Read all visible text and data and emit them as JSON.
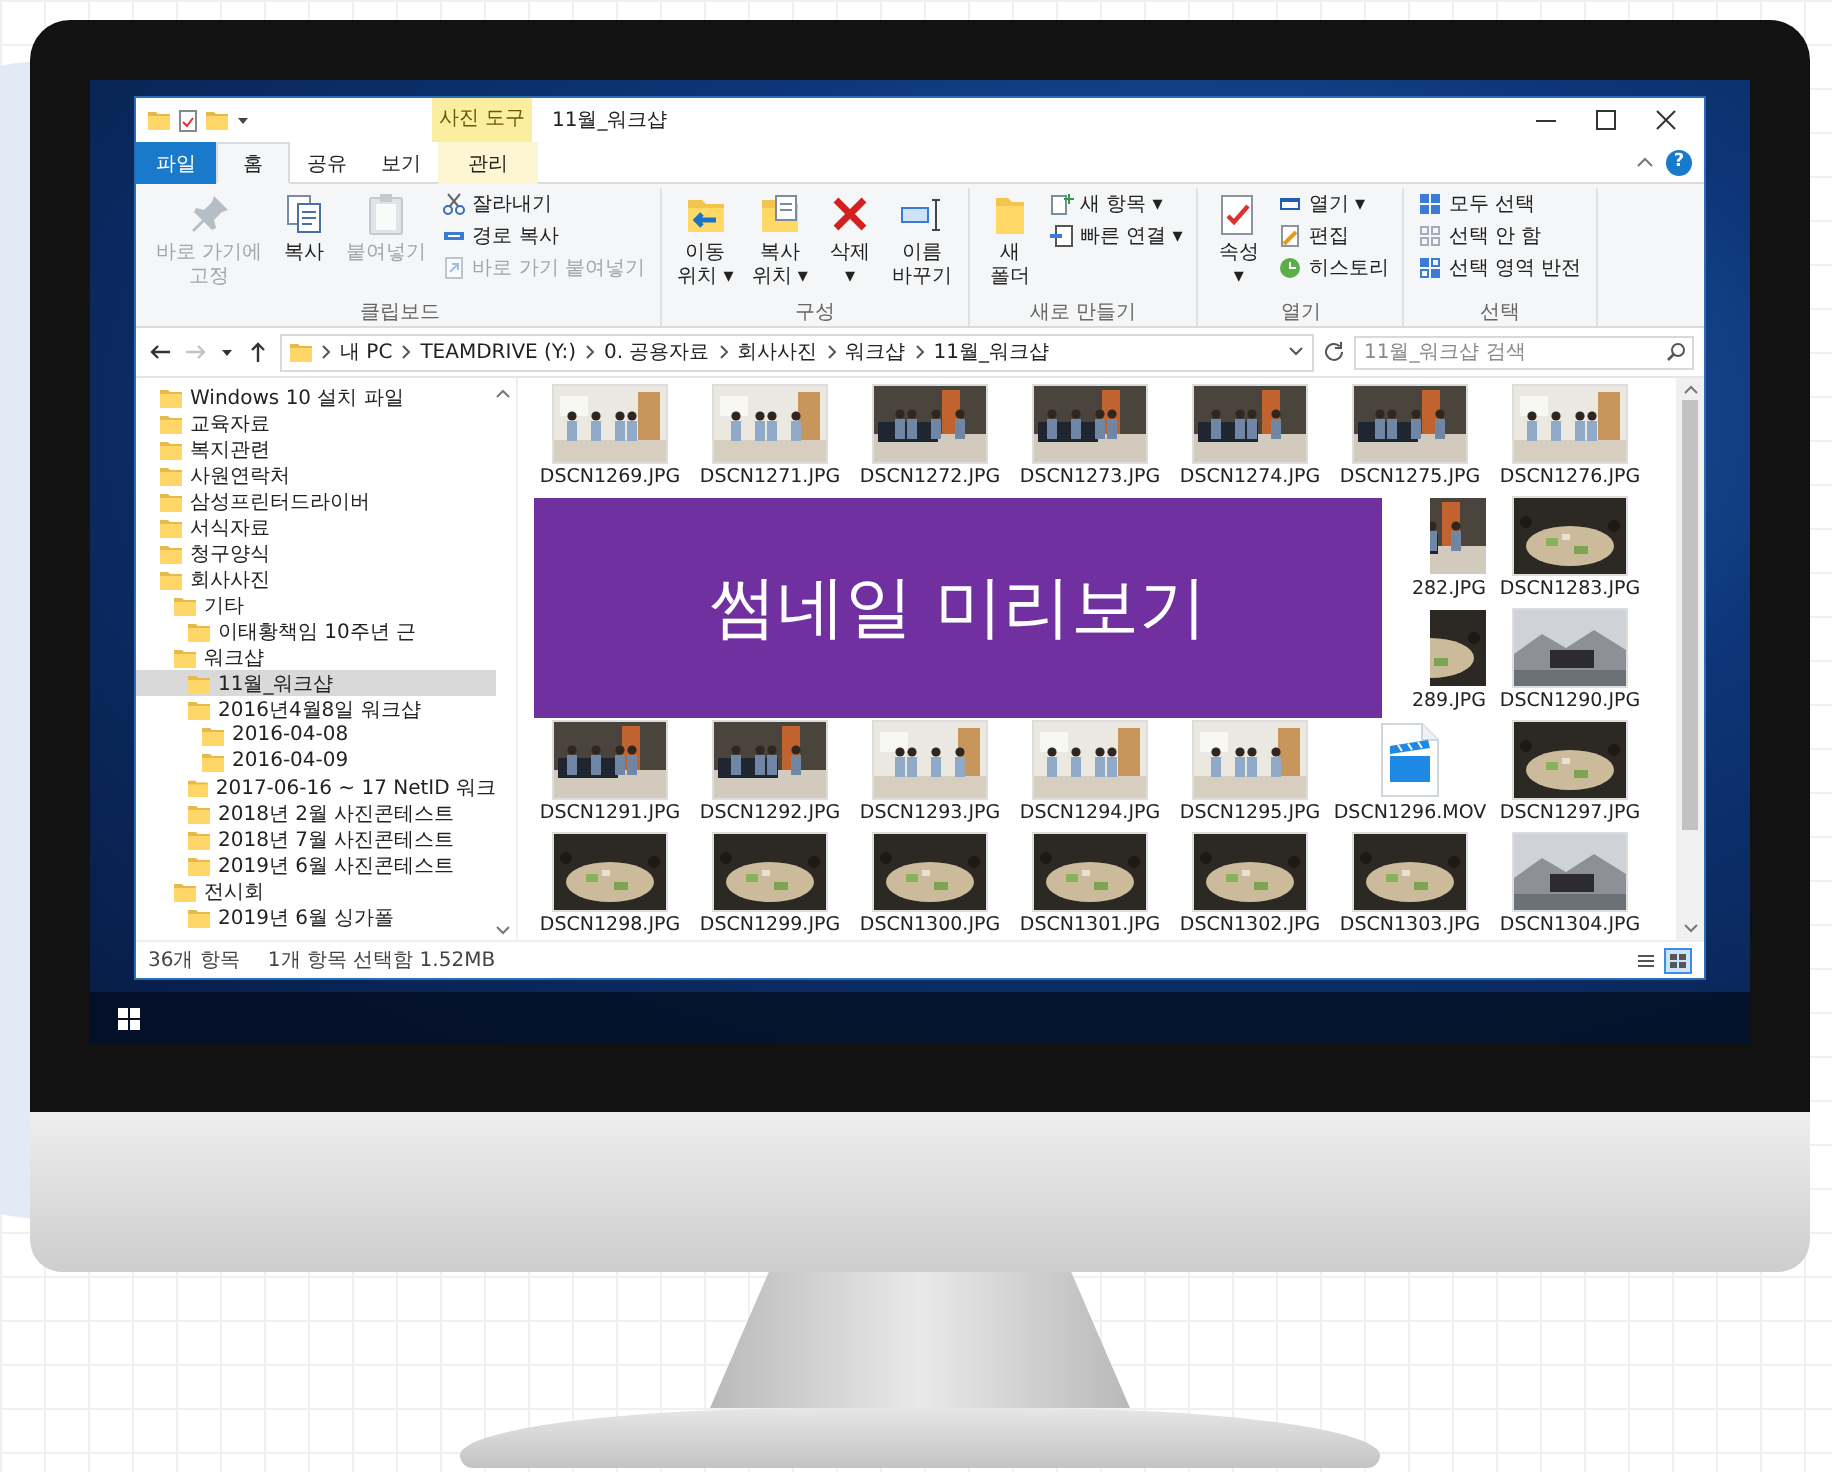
{
  "window": {
    "title": "11월_워크샵",
    "context_tab_group": "사진 도구",
    "help_button": "?"
  },
  "tabs": [
    {
      "label": "파일",
      "kind": "file",
      "selected": false
    },
    {
      "label": "홈",
      "kind": "normal",
      "selected": true
    },
    {
      "label": "공유",
      "kind": "normal",
      "selected": false
    },
    {
      "label": "보기",
      "kind": "normal",
      "selected": false
    },
    {
      "label": "관리",
      "kind": "context",
      "selected": false
    }
  ],
  "ribbon": {
    "groups": [
      {
        "label": "클립보드",
        "buttons": [
          {
            "label": "바로 가기에\n고정",
            "kind": "large",
            "disabled": true
          },
          {
            "label": "복사",
            "kind": "large",
            "disabled": false
          },
          {
            "label": "붙여넣기",
            "kind": "large",
            "disabled": true
          },
          {
            "label": "잘라내기",
            "kind": "small",
            "disabled": false
          },
          {
            "label": "경로 복사",
            "kind": "small",
            "disabled": false
          },
          {
            "label": "바로 가기 붙여넣기",
            "kind": "small",
            "disabled": true
          }
        ]
      },
      {
        "label": "구성",
        "buttons": [
          {
            "label": "이동\n위치 ▾",
            "kind": "large",
            "disabled": false
          },
          {
            "label": "복사\n위치 ▾",
            "kind": "large",
            "disabled": false
          },
          {
            "label": "삭제\n▾",
            "kind": "large",
            "disabled": false
          },
          {
            "label": "이름\n바꾸기",
            "kind": "large",
            "disabled": false
          }
        ]
      },
      {
        "label": "새로 만들기",
        "buttons": [
          {
            "label": "새\n폴더",
            "kind": "large",
            "disabled": false
          },
          {
            "label": "새 항목 ▾",
            "kind": "small",
            "disabled": false
          },
          {
            "label": "빠른 연결 ▾",
            "kind": "small",
            "disabled": false
          }
        ]
      },
      {
        "label": "열기",
        "buttons": [
          {
            "label": "속성\n▾",
            "kind": "large",
            "disabled": false
          },
          {
            "label": "열기 ▾",
            "kind": "small",
            "disabled": false
          },
          {
            "label": "편집",
            "kind": "small",
            "disabled": false
          },
          {
            "label": "히스토리",
            "kind": "small",
            "disabled": false
          }
        ]
      },
      {
        "label": "선택",
        "buttons": [
          {
            "label": "모두 선택",
            "kind": "small",
            "disabled": false
          },
          {
            "label": "선택 안 함",
            "kind": "small",
            "disabled": false
          },
          {
            "label": "선택 영역 반전",
            "kind": "small",
            "disabled": false
          }
        ]
      }
    ]
  },
  "navigation_buttons": [
    {
      "disabled": false
    },
    {
      "disabled": true
    },
    {
      "disabled": false
    },
    {
      "disabled": false
    }
  ],
  "address": {
    "breadcrumbs": [
      "내 PC",
      "TEAMDRIVE (Y:)",
      "0. 공용자료",
      "회사사진",
      "워크샵",
      "11월_워크샵"
    ]
  },
  "search": {
    "placeholder": "11월_워크샵 검색"
  },
  "navigation_tree": [
    {
      "label": "Windows 10 설치 파일",
      "selected": false
    },
    {
      "label": "교육자료",
      "selected": false
    },
    {
      "label": "복지관련",
      "selected": false
    },
    {
      "label": "사원연락처",
      "selected": false
    },
    {
      "label": "삼성프린터드라이버",
      "selected": false
    },
    {
      "label": "서식자료",
      "selected": false
    },
    {
      "label": "청구양식",
      "selected": false
    },
    {
      "label": "회사사진",
      "selected": false,
      "children": [
        {
          "label": "기타",
          "selected": false,
          "children": [
            {
              "label": "이태황책임 10주년 근",
              "selected": false
            }
          ]
        },
        {
          "label": "워크샵",
          "selected": false,
          "children": [
            {
              "label": "11월_워크샵",
              "selected": true
            },
            {
              "label": "2016년4월8일 워크샵",
              "selected": false,
              "children": [
                {
                  "label": "2016-04-08",
                  "selected": false
                },
                {
                  "label": "2016-04-09",
                  "selected": false
                }
              ]
            },
            {
              "label": "2017-06-16 ~ 17 NetID 워크",
              "selected": false
            },
            {
              "label": "2018년 2월 사진콘테스트",
              "selected": false
            },
            {
              "label": "2018년 7월 사진콘테스트",
              "selected": false
            },
            {
              "label": "2019년 6월 사진콘테스트",
              "selected": false
            }
          ]
        },
        {
          "label": "전시회",
          "selected": false,
          "children": [
            {
              "label": "2019년 6월 싱가폴",
              "selected": false
            }
          ]
        }
      ]
    }
  ],
  "files": {
    "rows": [
      [
        {
          "name": "DSCN1269.JPG",
          "partial": false
        },
        {
          "name": "DSCN1271.JPG",
          "partial": false
        },
        {
          "name": "DSCN1272.JPG",
          "partial": false
        },
        {
          "name": "DSCN1273.JPG",
          "partial": false
        },
        {
          "name": "DSCN1274.JPG",
          "partial": false
        },
        {
          "name": "DSCN1275.JPG",
          "partial": false
        },
        {
          "name": "DSCN1276.JPG",
          "partial": false
        }
      ],
      [
        {
          "name": "282.JPG",
          "partial": true
        },
        {
          "name": "DSCN1283.JPG",
          "partial": false
        }
      ],
      [
        {
          "name": "289.JPG",
          "partial": true
        },
        {
          "name": "DSCN1290.JPG",
          "partial": false
        }
      ],
      [
        {
          "name": "DSCN1291.JPG",
          "partial": false
        },
        {
          "name": "DSCN1292.JPG",
          "partial": false
        },
        {
          "name": "DSCN1293.JPG",
          "partial": false
        },
        {
          "name": "DSCN1294.JPG",
          "partial": false
        },
        {
          "name": "DSCN1295.JPG",
          "partial": false
        },
        {
          "name": "DSCN1296.MOV",
          "kind": "video",
          "partial": false
        },
        {
          "name": "DSCN1297.JPG",
          "partial": false
        }
      ],
      [
        {
          "name": "DSCN1298.JPG",
          "partial": false
        },
        {
          "name": "DSCN1299.JPG",
          "partial": false
        },
        {
          "name": "DSCN1300.JPG",
          "partial": false
        },
        {
          "name": "DSCN1301.JPG",
          "partial": false
        },
        {
          "name": "DSCN1302.JPG",
          "partial": false
        },
        {
          "name": "DSCN1303.JPG",
          "partial": false
        },
        {
          "name": "DSCN1304.JPG",
          "partial": false
        }
      ]
    ]
  },
  "overlay": {
    "caption": "썸네일 미리보기"
  },
  "status_bar": {
    "item_count": "36개 항목",
    "selection": "1개 항목 선택함 1.52MB"
  },
  "view_modes": [
    {
      "selected": false
    },
    {
      "selected": true
    }
  ]
}
